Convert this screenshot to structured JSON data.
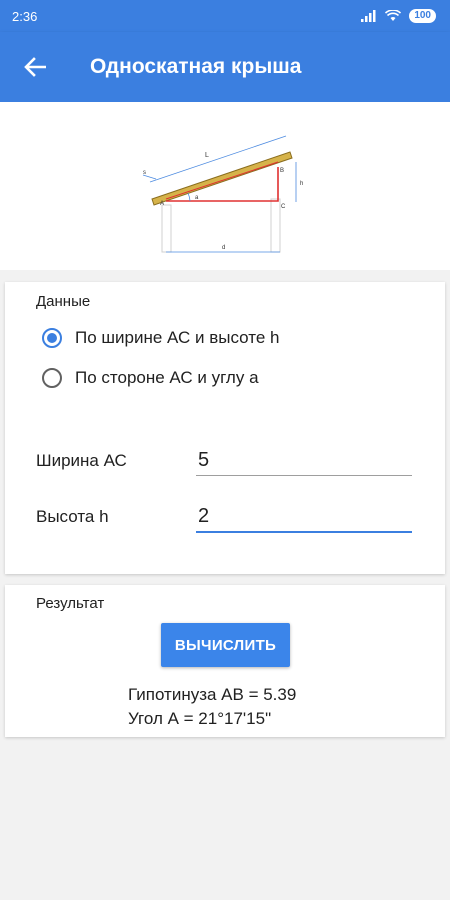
{
  "status": {
    "time": "2:36",
    "battery": "100"
  },
  "header": {
    "title": "Односкатная крыша"
  },
  "diagram": {
    "labels": {
      "L": "L",
      "s": "s",
      "B": "B",
      "A": "A",
      "C": "C",
      "h": "h",
      "a": "a",
      "d": "d"
    },
    "colors": {
      "rafter": "#d6b34a",
      "triangle": "#e03030",
      "dim": "#4d8be0"
    }
  },
  "data_section": {
    "title": "Данные",
    "options": [
      {
        "label": "По ширине АС и высоте h",
        "selected": true
      },
      {
        "label": "По стороне АС и углу а",
        "selected": false
      }
    ],
    "fields": [
      {
        "label": "Ширина АС",
        "value": "5"
      },
      {
        "label": "Высота h",
        "value": "2"
      }
    ]
  },
  "result_section": {
    "title": "Результат",
    "button_label": "ВЫЧИСЛИТЬ",
    "hypotenuse": "Гипотинуза АВ = 5.39",
    "angle": "Угол А = 21°17'15\""
  },
  "colors": {
    "primary": "#3b7fe0",
    "button": "#3b85ea",
    "background": "#f2f2f2"
  }
}
